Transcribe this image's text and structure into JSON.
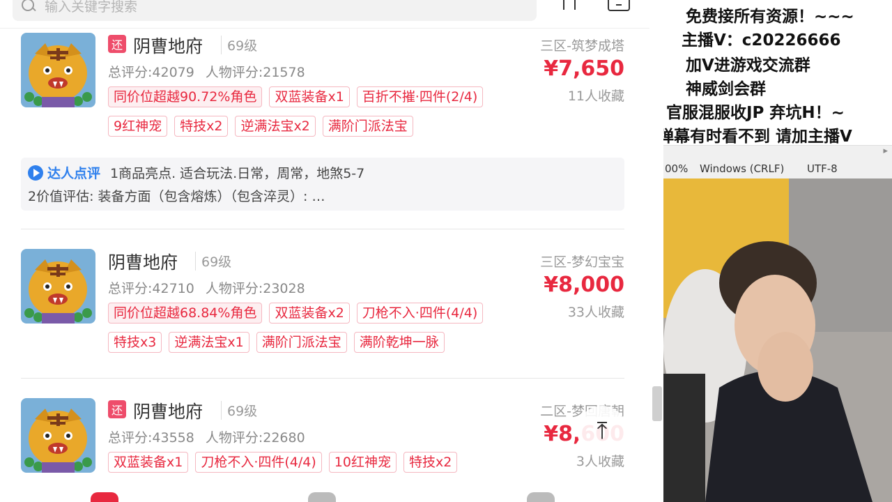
{
  "search": {
    "placeholder": "输入关键字搜索"
  },
  "listings": [
    {
      "returned_badge": "还",
      "name": "阴曹地府",
      "level": "69级",
      "total_score": "总评分:42079",
      "char_score": "人物评分:21578",
      "server": "三区-筑梦成塔",
      "price": "¥7,650",
      "favorites": "11人收藏",
      "tags": [
        "同价位超越90.72%角色",
        "双蓝装备x1",
        "百折不摧·四件(2/4)",
        "9红神宠",
        "特技x2",
        "逆满法宝x2",
        "满阶门派法宝"
      ],
      "review": {
        "label": "达人点评",
        "line1": "1商品亮点. 适合玩法.日常，周常，地煞5-7",
        "line2": "2价值评估:   装备方面（包含熔炼）（包含淬灵）: …"
      }
    },
    {
      "name": "阴曹地府",
      "level": "69级",
      "total_score": "总评分:42710",
      "char_score": "人物评分:23028",
      "server": "三区-梦幻宝宝",
      "price": "¥8,000",
      "favorites": "33人收藏",
      "tags": [
        "同价位超越68.84%角色",
        "双蓝装备x2",
        "刀枪不入·四件(4/4)",
        "特技x3",
        "逆满法宝x1",
        "满阶门派法宝",
        "满阶乾坤一脉"
      ]
    },
    {
      "returned_badge": "还",
      "name": "阴曹地府",
      "level": "69级",
      "total_score": "总评分:43558",
      "char_score": "人物评分:22680",
      "server": "二区-梦回唐朝",
      "price": "¥8,600",
      "favorites": "3人收藏",
      "tags": [
        "双蓝装备x1",
        "刀枪不入·四件(4/4)",
        "10红神宠",
        "特技x2"
      ]
    }
  ],
  "scroll_top_glyph": "⤒",
  "overlay": {
    "lines": [
      "免费接所有资源！~~~",
      "主播V：c20226666",
      "加V进游戏交流群",
      "神威剑会群",
      "官服混服收JP   弃坑H！~",
      "弹幕有时看不到 请加主播V"
    ],
    "editor_status": [
      "00%",
      "Windows (CRLF)",
      "UTF-8"
    ]
  },
  "colors": {
    "price_red": "#e8283f",
    "review_blue": "#2f80ed",
    "tag_border": "#f5b7c0"
  }
}
